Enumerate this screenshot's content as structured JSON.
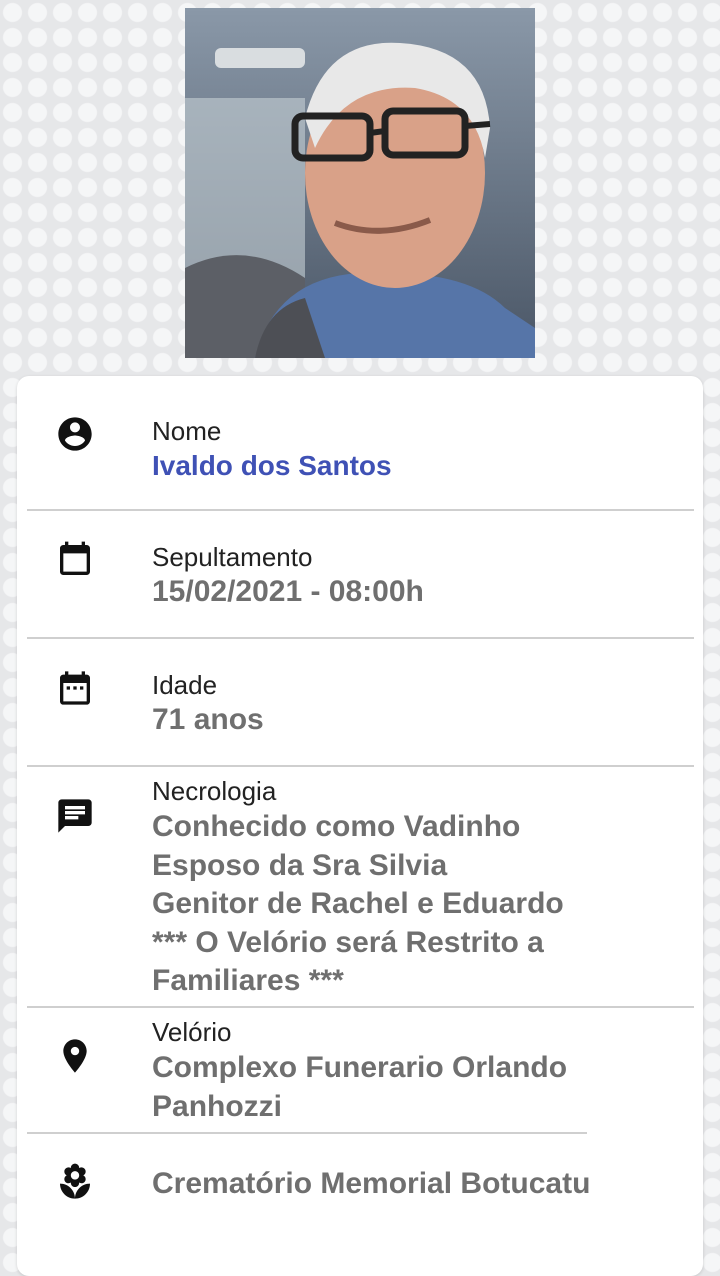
{
  "profile": {
    "photo_alt": "Foto do falecido"
  },
  "fields": {
    "nome": {
      "label": "Nome",
      "value": "Ivaldo dos Santos"
    },
    "sepultamento": {
      "label": "Sepultamento",
      "value": "15/02/2021 - 08:00h"
    },
    "idade": {
      "label": "Idade",
      "value": "71 anos"
    },
    "necrologia": {
      "label": "Necrologia",
      "value": "Conhecido como Vadinho\nEsposo da Sra Silvia\nGenitor de Rachel e Eduardo\n*** O Velório será Restrito a Familiares ***"
    },
    "velorio": {
      "label": "Velório",
      "value": "Complexo Funerario Orlando Panhozzi"
    },
    "crematorio": {
      "value": "Crematório Memorial Botucatu"
    }
  },
  "icons": {
    "nome": "account-circle-icon",
    "sepultamento": "calendar-icon",
    "idade": "calendar-dots-icon",
    "necrologia": "message-icon",
    "velorio": "map-pin-icon",
    "crematorio": "flower-icon"
  },
  "colors": {
    "name_accent": "#3f51b5",
    "value_text": "#6f6f6f",
    "label_text": "#222222"
  }
}
